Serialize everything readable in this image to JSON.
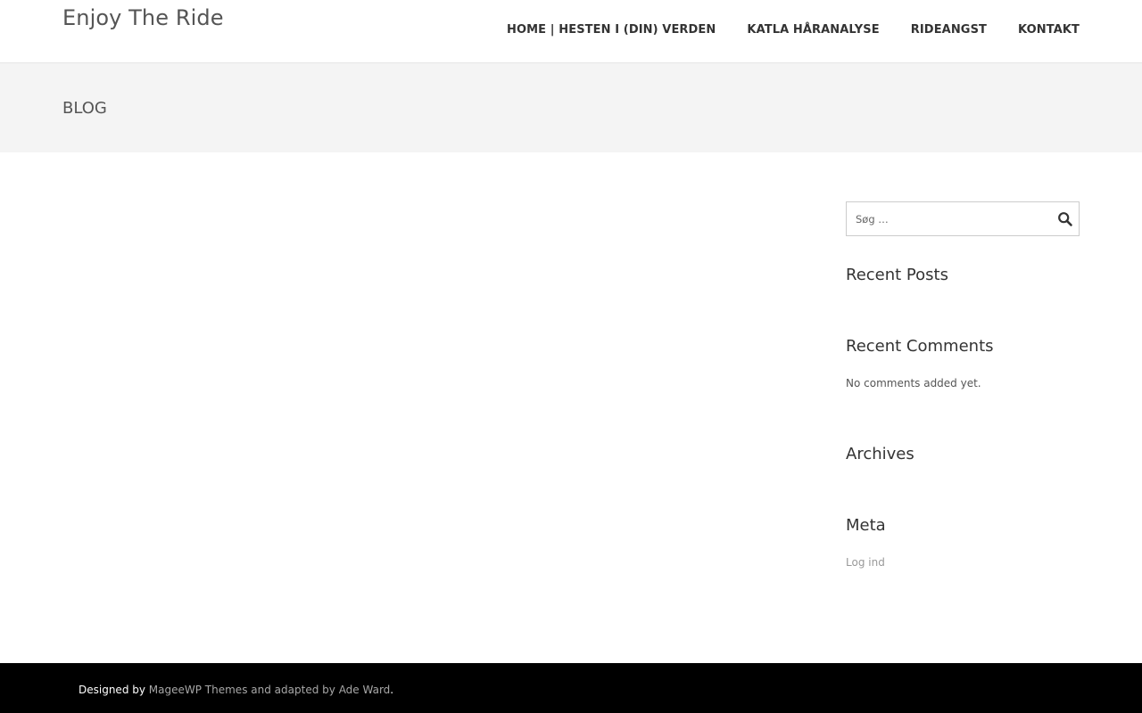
{
  "site": {
    "title": "Enjoy The Ride"
  },
  "nav": {
    "items": [
      {
        "label": "HOME | HESTEN I (DIN) VERDEN"
      },
      {
        "label": "KATLA HÅRANALYSE"
      },
      {
        "label": "RIDEANGST"
      },
      {
        "label": "KONTAKT"
      }
    ]
  },
  "banner": {
    "heading": "BLOG"
  },
  "sidebar": {
    "search": {
      "placeholder": "Søg …",
      "icon": "search-icon"
    },
    "recent_posts": {
      "title": "Recent Posts"
    },
    "recent_comments": {
      "title": "Recent Comments",
      "empty_text": "No comments added yet."
    },
    "archives": {
      "title": "Archives"
    },
    "meta": {
      "title": "Meta",
      "links": [
        {
          "label": "Log ind"
        }
      ]
    }
  },
  "footer": {
    "designed_by": "Designed by",
    "theme_link": "MageeWP Themes",
    "adapted_text": "and adapted by",
    "author_link": "Ade Ward",
    "end": "."
  },
  "colors": {
    "header_bg": "#ffffff",
    "banner_bg": "#f4f4f4",
    "footer_bg": "#000000",
    "nav_text": "#333333",
    "muted_link": "#999999"
  }
}
